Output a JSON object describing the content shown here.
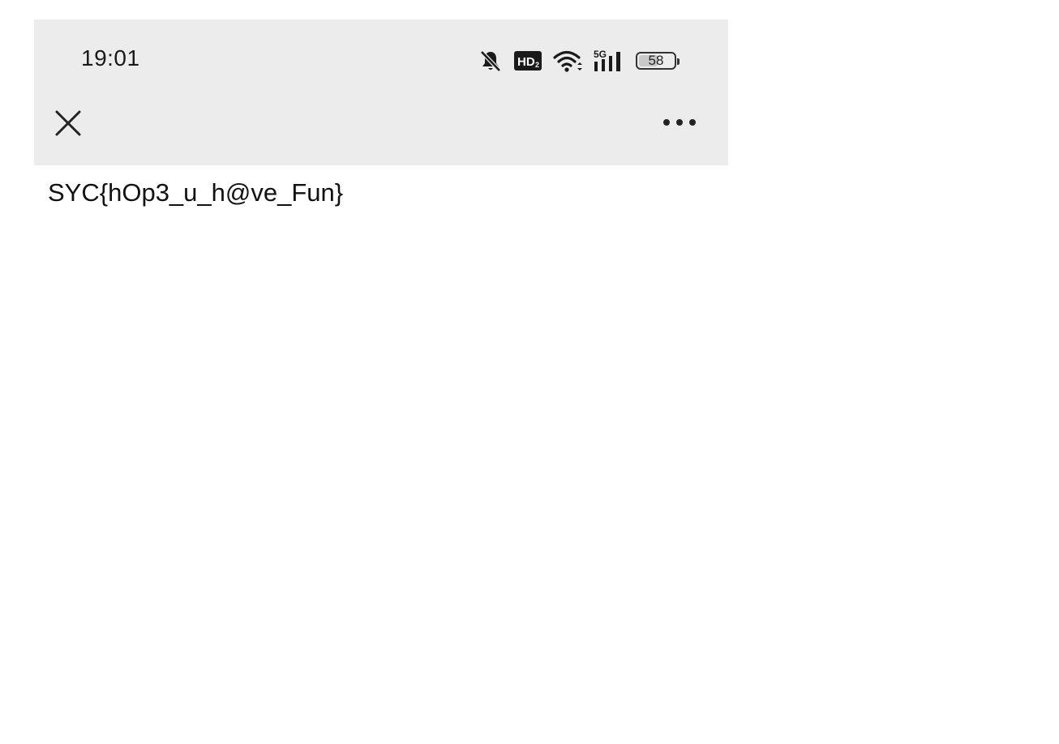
{
  "status_bar": {
    "time": "19:01",
    "icons": [
      "bell-muted-icon",
      "hd-icon",
      "wifi-icon",
      "signal-5g-icon",
      "battery-icon"
    ],
    "hd_label": "HD",
    "hd_sub": "2",
    "network_label": "5G",
    "battery_level": "58",
    "battery_fraction": 0.58
  },
  "toolbar": {
    "close_icon": "close-icon",
    "more_icon": "more-options-icon"
  },
  "content": {
    "text": "SYC{hOp3_u_h@ve_Fun}"
  },
  "colors": {
    "header_bg": "#ececec",
    "page_bg": "#ffffff",
    "text": "#111111"
  }
}
